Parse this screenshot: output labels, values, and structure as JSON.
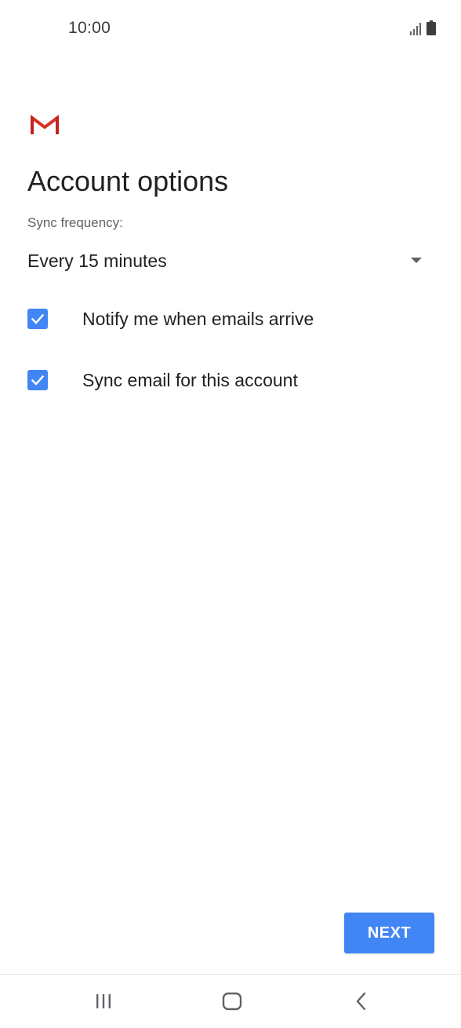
{
  "status_bar": {
    "time": "10:00",
    "icons": [
      "signal-icon",
      "battery-icon"
    ]
  },
  "app": {
    "logo_icon": "gmail-logo-icon",
    "brand_color": "#d93025"
  },
  "page": {
    "title": "Account options"
  },
  "sync": {
    "label": "Sync frequency:",
    "value": "Every 15 minutes"
  },
  "options": [
    {
      "label": "Notify me when emails arrive",
      "checked": true
    },
    {
      "label": "Sync email for this account",
      "checked": true
    }
  ],
  "actions": {
    "next_label": "NEXT",
    "accent_color": "#4285f4"
  },
  "nav_bar": {
    "icons": [
      "recent-apps-icon",
      "home-icon",
      "back-icon"
    ]
  }
}
